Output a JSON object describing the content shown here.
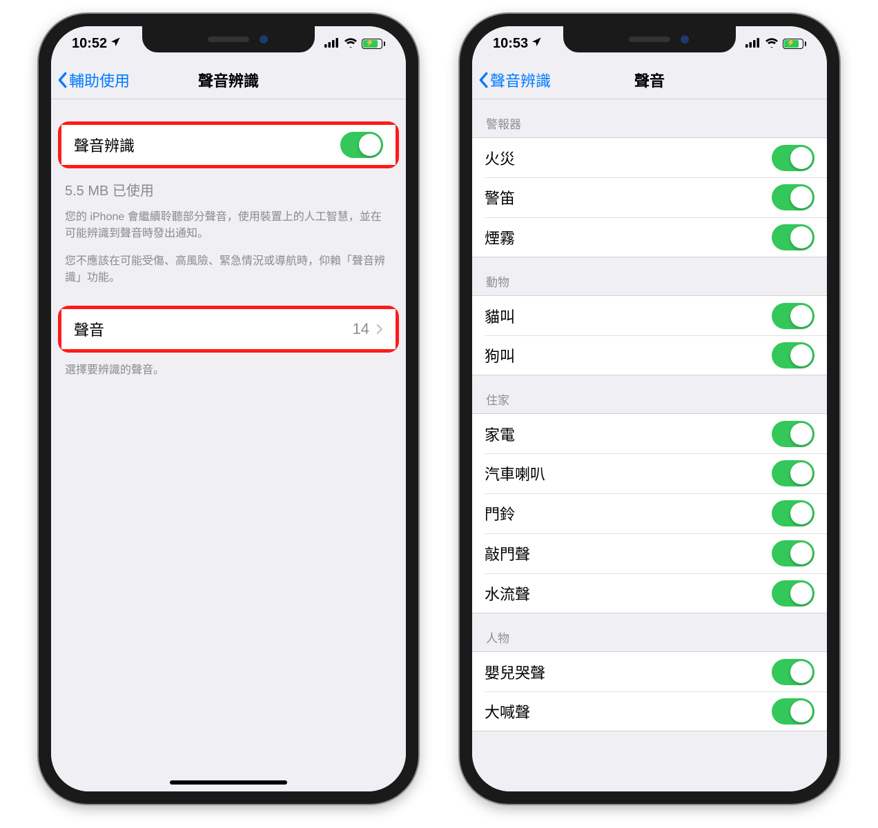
{
  "phoneLeft": {
    "status": {
      "time": "10:52",
      "hasLocation": true
    },
    "nav": {
      "back": "輔助使用",
      "title": "聲音辨識"
    },
    "toggleRow": {
      "label": "聲音辨識",
      "on": true
    },
    "storage": "5.5 MB 已使用",
    "desc1": "您的 iPhone 會繼續聆聽部分聲音，使用裝置上的人工智慧，並在可能辨識到聲音時發出通知。",
    "desc2": "您不應該在可能受傷、高風險、緊急情況或導航時，仰賴「聲音辨識」功能。",
    "soundsRow": {
      "label": "聲音",
      "value": "14"
    },
    "soundsFooter": "選擇要辨識的聲音。"
  },
  "phoneRight": {
    "status": {
      "time": "10:53",
      "hasLocation": true
    },
    "nav": {
      "back": "聲音辨識",
      "title": "聲音"
    },
    "sections": [
      {
        "header": "警報器",
        "items": [
          {
            "label": "火災",
            "on": true
          },
          {
            "label": "警笛",
            "on": true
          },
          {
            "label": "煙霧",
            "on": true
          }
        ]
      },
      {
        "header": "動物",
        "items": [
          {
            "label": "貓叫",
            "on": true
          },
          {
            "label": "狗叫",
            "on": true
          }
        ]
      },
      {
        "header": "住家",
        "items": [
          {
            "label": "家電",
            "on": true
          },
          {
            "label": "汽車喇叭",
            "on": true
          },
          {
            "label": "門鈴",
            "on": true
          },
          {
            "label": "敲門聲",
            "on": true
          },
          {
            "label": "水流聲",
            "on": true
          }
        ]
      },
      {
        "header": "人物",
        "items": [
          {
            "label": "嬰兒哭聲",
            "on": true
          },
          {
            "label": "大喊聲",
            "on": true
          }
        ]
      }
    ]
  }
}
